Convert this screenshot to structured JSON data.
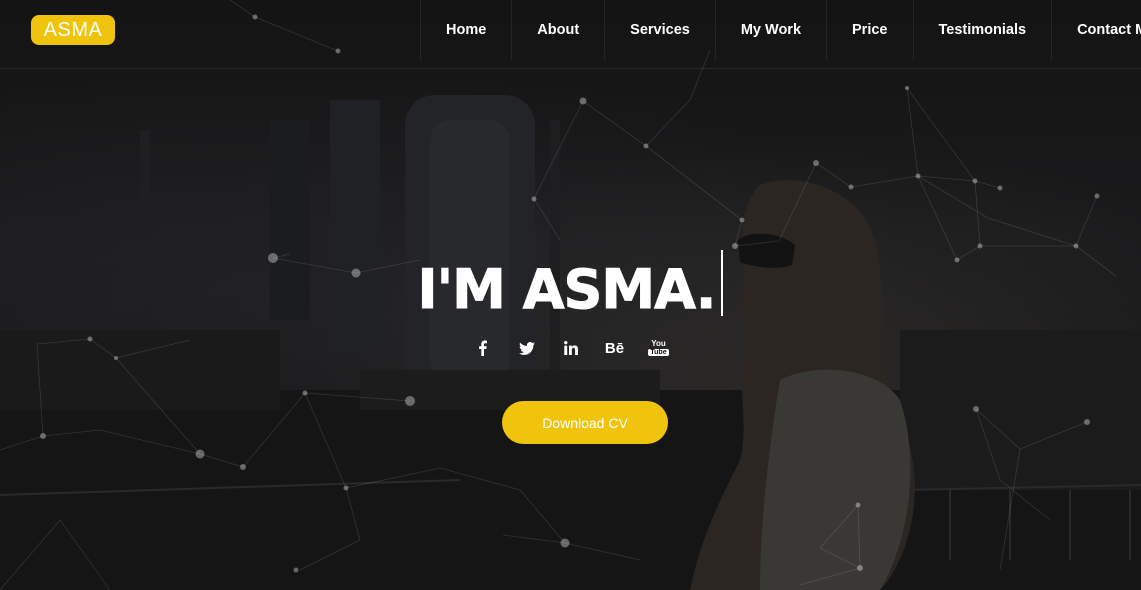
{
  "brand": {
    "logo_text": "ASMA",
    "accent_color": "#f0c40c"
  },
  "nav": {
    "items": [
      {
        "label": "Home"
      },
      {
        "label": "About"
      },
      {
        "label": "Services"
      },
      {
        "label": "My Work"
      },
      {
        "label": "Price"
      },
      {
        "label": "Testimonials"
      },
      {
        "label": "Contact Me"
      }
    ]
  },
  "hero": {
    "title": "I'M ASMA.",
    "social": [
      {
        "icon": "facebook-icon"
      },
      {
        "icon": "twitter-icon"
      },
      {
        "icon": "linkedin-icon"
      },
      {
        "icon": "behance-icon",
        "text": "Bē"
      },
      {
        "icon": "youtube-icon",
        "text_top": "You",
        "text_bottom": "Tube"
      }
    ],
    "cta_label": "Download CV"
  }
}
